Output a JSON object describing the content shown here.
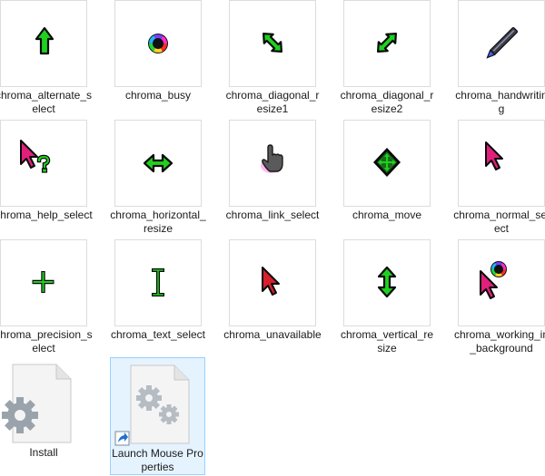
{
  "files": [
    {
      "label": "chroma_alternate_select",
      "icon": "up-arrow-icon"
    },
    {
      "label": "chroma_busy",
      "icon": "rainbow-ring-icon"
    },
    {
      "label": "chroma_diagonal_resize1",
      "icon": "diagonal-resize-nw-se-icon"
    },
    {
      "label": "chroma_diagonal_resize2",
      "icon": "diagonal-resize-ne-sw-icon"
    },
    {
      "label": "chroma_handwriting",
      "icon": "pen-icon"
    },
    {
      "label": "chroma_help_select",
      "icon": "help-select-icon"
    },
    {
      "label": "chroma_horizontal_resize",
      "icon": "horizontal-resize-icon"
    },
    {
      "label": "chroma_link_select",
      "icon": "hand-pointer-icon"
    },
    {
      "label": "chroma_move",
      "icon": "move-icon"
    },
    {
      "label": "chroma_normal_select",
      "icon": "arrow-pointer-icon"
    },
    {
      "label": "chroma_precision_select",
      "icon": "crosshair-icon"
    },
    {
      "label": "chroma_text_select",
      "icon": "text-ibeam-icon"
    },
    {
      "label": "chroma_unavailable",
      "icon": "arrow-pointer-red-icon"
    },
    {
      "label": "chroma_vertical_resize",
      "icon": "vertical-resize-icon"
    },
    {
      "label": "chroma_working_in_background",
      "icon": "working-background-icon"
    }
  ],
  "install": {
    "label": "Install",
    "icon": "settings-file-icon"
  },
  "launch": {
    "label": "Launch Mouse Properties",
    "icon": "settings-file-shortcut-icon"
  },
  "colors": {
    "green": "#1fd11f",
    "outline": "#0a0a0a",
    "magenta": "#e0207a",
    "selection": "#e5f3ff"
  }
}
